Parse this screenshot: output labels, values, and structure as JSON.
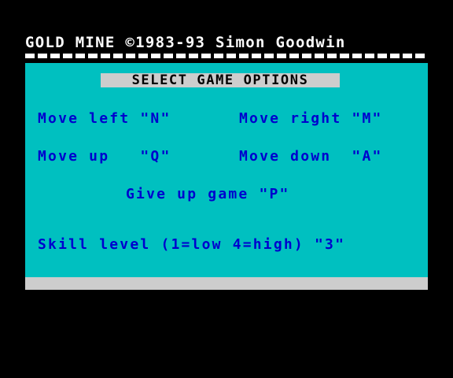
{
  "title": "GOLD MINE ©1983-93 Simon Goodwin",
  "heading": "SELECT GAME OPTIONS",
  "options": {
    "move_left": "Move left \"N\"",
    "move_right": "Move right \"M\"",
    "move_up": "Move up   \"Q\"",
    "move_down": "Move down  \"A\"",
    "give_up": "Give up game \"P\"",
    "skill": "Skill level (1=low 4=high) \"3\""
  },
  "colors": {
    "background": "#000000",
    "panel": "#00c0c0",
    "text_blue": "#0000cd",
    "title_white": "#ffffff",
    "heading_bg": "#cdcdcd"
  }
}
